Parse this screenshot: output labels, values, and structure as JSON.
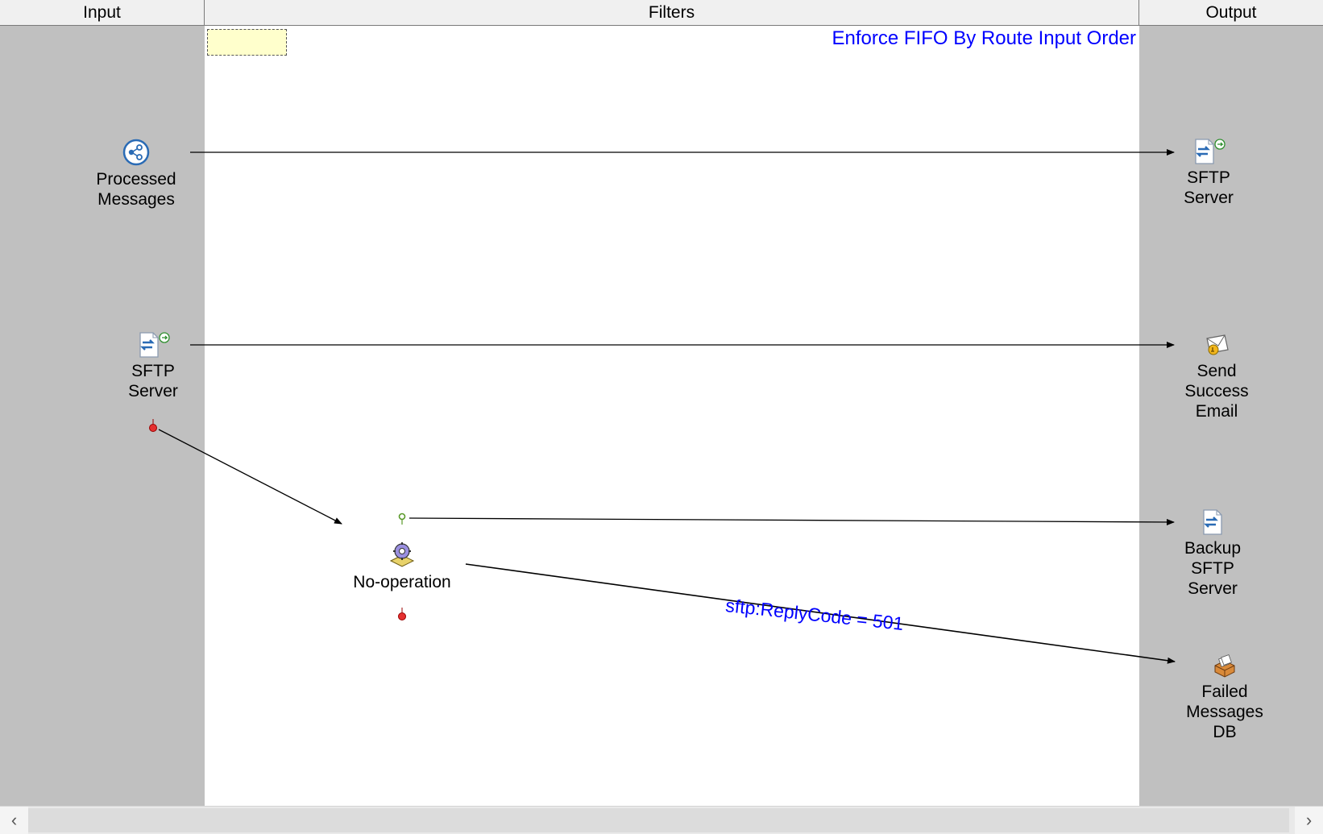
{
  "columns": {
    "input": "Input",
    "filters": "Filters",
    "output": "Output"
  },
  "title": "Enforce FIFO By Route Input Order",
  "input_nodes": [
    {
      "label": "Processed\nMessages",
      "icon": "share-network-icon"
    },
    {
      "label": "SFTP\nServer",
      "icon": "sftp-transfer-icon"
    }
  ],
  "filter_nodes": [
    {
      "label": "No-operation",
      "icon": "no-operation-gear-icon"
    }
  ],
  "output_nodes": [
    {
      "label": "SFTP\nServer",
      "icon": "sftp-transfer-icon"
    },
    {
      "label": "Send\nSuccess\nEmail",
      "icon": "email-icon"
    },
    {
      "label": "Backup\nSFTP\nServer",
      "icon": "sftp-document-icon"
    },
    {
      "label": "Failed\nMessages\nDB",
      "icon": "database-icon"
    }
  ],
  "connections": [
    {
      "from": "Processed Messages",
      "to": "SFTP Server"
    },
    {
      "from": "SFTP Server",
      "to": "Send Success Email"
    },
    {
      "from": "SFTP Server (error)",
      "to": "No-operation"
    },
    {
      "from": "No-operation (success)",
      "to": "Backup SFTP Server"
    },
    {
      "from": "No-operation",
      "to": "Failed Messages DB",
      "condition": "sftp:ReplyCode = 501"
    }
  ],
  "colors": {
    "lane": "#c0c0c0",
    "title": "#0000ff",
    "condition": "#0000ff",
    "note": "#ffffcc"
  },
  "scrollbar": {
    "left_icon": "chevron-left-icon",
    "right_icon": "chevron-right-icon"
  }
}
